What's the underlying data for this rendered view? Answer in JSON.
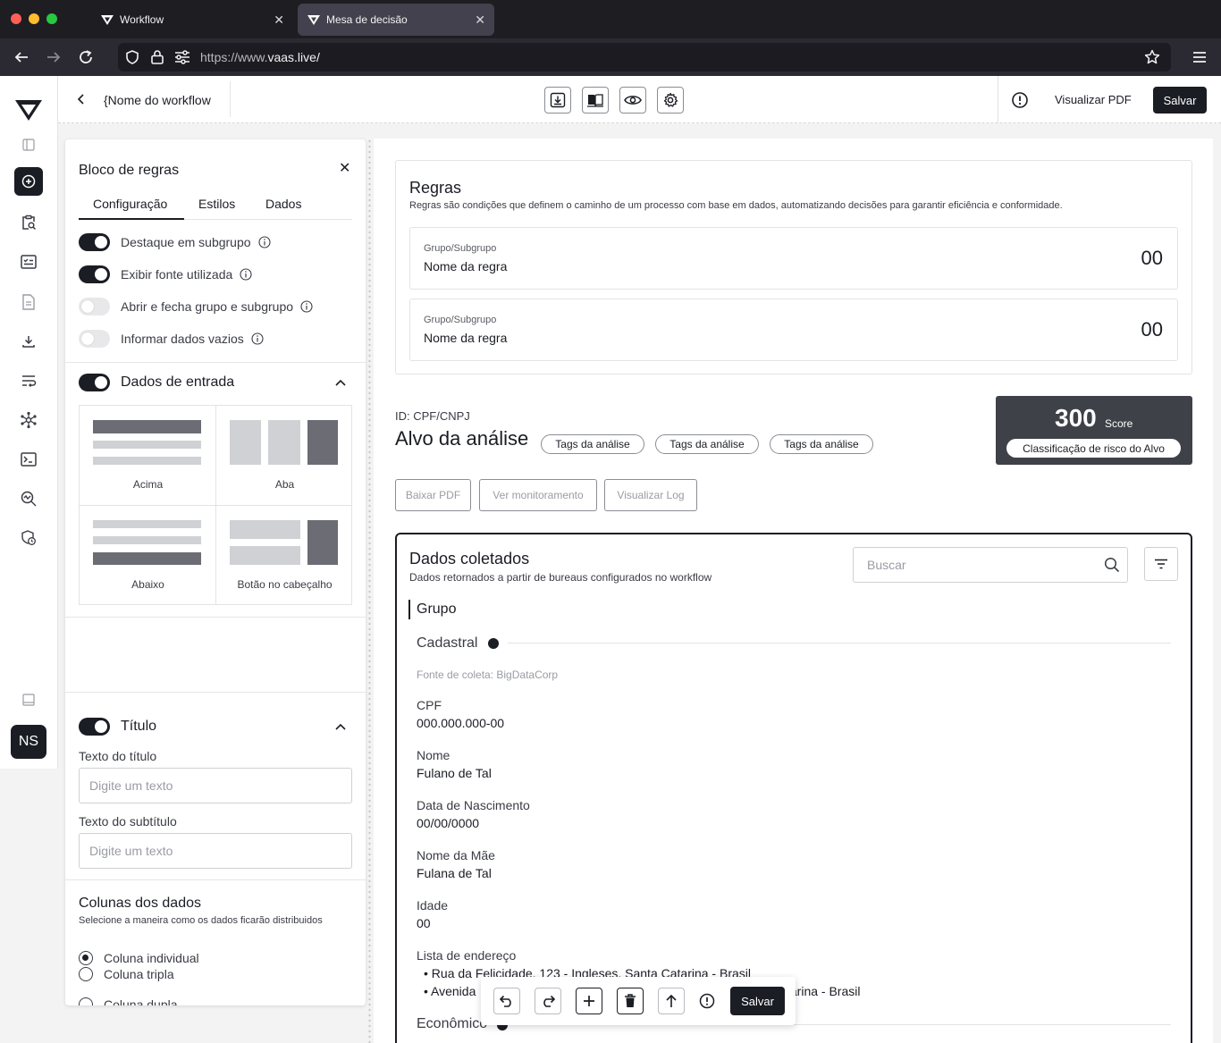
{
  "browser": {
    "tabs": [
      {
        "label": "Workflow",
        "active": false
      },
      {
        "label": "Mesa de decisão",
        "active": true
      }
    ],
    "url": {
      "prefix": "https://www.",
      "domain": "vaas.live/"
    },
    "colors": {
      "close": "#ff5f57",
      "minimize": "#febc2e",
      "maximize": "#28c840"
    }
  },
  "app": {
    "header": {
      "workflow_name": "{Nome do workflow",
      "tools": [
        "download-icon",
        "book-icon",
        "eye-icon",
        "gear-icon"
      ],
      "preview_pdf_label": "Visualizar PDF",
      "save_label": "Salvar"
    },
    "sidebar": {
      "items": [
        "add-circle-icon",
        "clipboard-search-icon",
        "checklist-icon",
        "document-icon",
        "download-icon",
        "text-wrap-icon",
        "network-icon",
        "terminal-icon",
        "search-analytics-icon",
        "shield-clock-icon"
      ],
      "avatar_initials": "NS"
    },
    "panel": {
      "title": "Bloco de regras",
      "tabs": [
        "Configuração",
        "Estilos",
        "Dados"
      ],
      "active_tab": "Configuração",
      "toggles": [
        {
          "label": "Destaque em subgrupo",
          "on": true
        },
        {
          "label": "Exibir fonte utilizada",
          "on": true
        },
        {
          "label": "Abrir e fecha grupo e subgrupo",
          "on": false
        },
        {
          "label": "Informar dados vazios",
          "on": false
        }
      ],
      "input_section": {
        "label": "Dados de entrada",
        "on": true,
        "layouts": [
          "Acima",
          "Aba",
          "Abaixo",
          "Botão no cabeçalho"
        ]
      },
      "title_section": {
        "label": "Título",
        "on": true,
        "title_label": "Texto do título",
        "title_placeholder": "Digite um texto",
        "subtitle_label": "Texto do subtítulo",
        "subtitle_placeholder": "Digite um texto"
      },
      "columns": {
        "title": "Colunas dos dados",
        "subtitle": "Selecione a maneira como os dados ficarão distribuidos",
        "options": [
          "Coluna individual",
          "Coluna dupla",
          "Coluna tripla"
        ],
        "selected": "Coluna individual"
      }
    },
    "canvas": {
      "rules": {
        "title": "Regras",
        "description": "Regras são condições que definem o caminho de um processo com base em dados, automatizando decisões para garantir eficiência e conformidade.",
        "items": [
          {
            "group": "Grupo/Subgrupo",
            "name": "Nome da regra",
            "score": "00"
          },
          {
            "group": "Grupo/Subgrupo",
            "name": "Nome da regra",
            "score": "00"
          }
        ]
      },
      "target": {
        "id_label": "ID: CPF/CNPJ",
        "title": "Alvo da análise",
        "tags": [
          "Tags da análise",
          "Tags da análise",
          "Tags da análise"
        ],
        "score_value": "300",
        "score_unit": "Score",
        "score_class": "Classificação de risco do Alvo",
        "actions": [
          "Baixar PDF",
          "Ver monitoramento",
          "Visualizar Log"
        ]
      },
      "collected": {
        "title": "Dados coletados",
        "subtitle": "Dados retornados a partir de bureaus configurados no workflow",
        "search_placeholder": "Buscar",
        "group_label": "Grupo",
        "subgroup": "Cadastral",
        "source": "Fonte de coleta: BigDataCorp",
        "fields": [
          {
            "label": "CPF",
            "value": "000.000.000-00"
          },
          {
            "label": "Nome",
            "value": "Fulano de Tal"
          },
          {
            "label": "Data de Nascimento",
            "value": "00/00/0000"
          },
          {
            "label": "Nome da Mãe",
            "value": "Fulana de Tal"
          },
          {
            "label": "Idade",
            "value": "00"
          }
        ],
        "address_label": "Lista de endereço",
        "addresses": [
          "•  Rua da Felicidade, 123 - Ingleses, Santa Catarina - Brasil",
          "•  Avenida",
          "tarina - Brasil"
        ],
        "next_subgroup": "Econômico"
      },
      "floating_toolbar": {
        "tools": [
          "undo-icon",
          "redo-icon",
          "add-icon",
          "trash-icon",
          "arrow-up-icon",
          "info-icon"
        ],
        "save_label": "Salvar"
      }
    }
  }
}
